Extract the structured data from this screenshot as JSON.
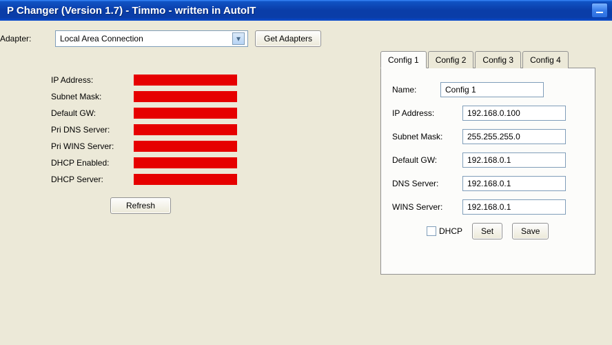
{
  "window": {
    "title": "P Changer (Version 1.7) - Timmo - written in AutoIT"
  },
  "adapter": {
    "label": "Adapter:",
    "selected": "Local Area Connection",
    "get_button": "Get Adapters"
  },
  "status_fields": {
    "ip_address": "IP Address:",
    "subnet_mask": "Subnet Mask:",
    "default_gw": "Default GW:",
    "pri_dns": "Pri DNS Server:",
    "pri_wins": "Pri WINS Server:",
    "dhcp_enabled": "DHCP Enabled:",
    "dhcp_server": "DHCP Server:"
  },
  "refresh_label": "Refresh",
  "tabs": [
    {
      "label": "Config 1"
    },
    {
      "label": "Config 2"
    },
    {
      "label": "Config 3"
    },
    {
      "label": "Config 4"
    }
  ],
  "config_form": {
    "name_label": "Name:",
    "name_value": "Config 1",
    "ip_label": "IP Address:",
    "ip_value": "192.168.0.100",
    "subnet_label": "Subnet Mask:",
    "subnet_value": "255.255.255.0",
    "gw_label": "Default GW:",
    "gw_value": "192.168.0.1",
    "dns_label": "DNS Server:",
    "dns_value": "192.168.0.1",
    "wins_label": "WINS Server:",
    "wins_value": "192.168.0.1",
    "dhcp_label": "DHCP",
    "set_label": "Set",
    "save_label": "Save"
  }
}
